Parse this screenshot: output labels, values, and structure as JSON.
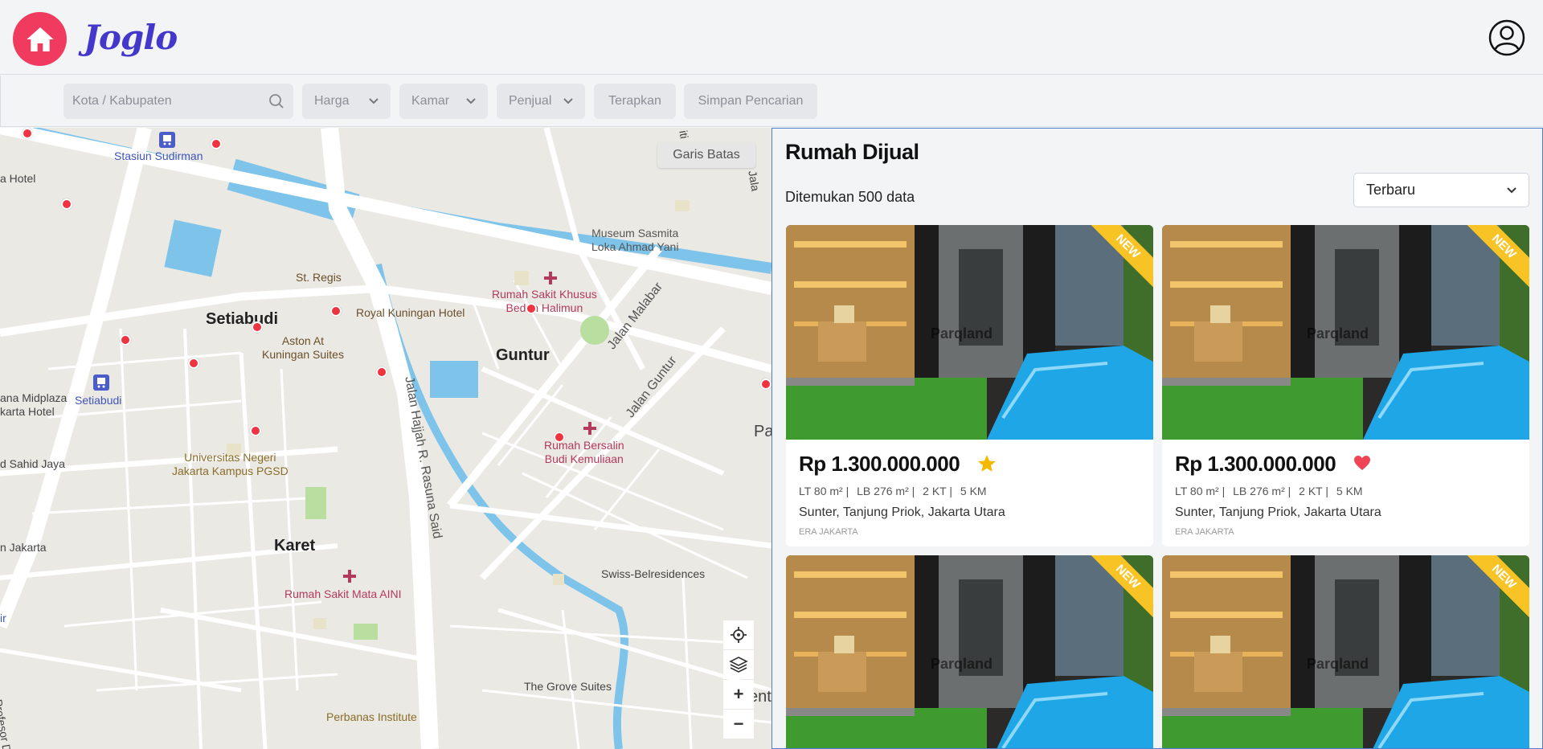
{
  "header": {
    "logo_text": "Joglo",
    "home_icon": "home-icon",
    "profile_icon": "user-circle-icon"
  },
  "filters": {
    "search_placeholder": "Kota / Kabupaten",
    "price_label": "Harga",
    "rooms_label": "Kamar",
    "seller_label": "Penjual",
    "apply_label": "Terapkan",
    "save_label": "Simpan Pencarian"
  },
  "map": {
    "boundary_button": "Garis Batas",
    "labels": {
      "stasiun_sudirman": "Stasiun Sudirman",
      "hotel_edge": "a Hotel",
      "st_regis": "St. Regis",
      "royal_kuningan": "Royal Kuningan Hotel",
      "setiabudi_district": "Setiabudi",
      "aston": "Aston At\nKuningan Suites",
      "midplaza": "ana Midplaza\nkarta Hotel",
      "setiabudi_station": "Setiabudi",
      "sahid": "d Sahid Jaya",
      "unj": "Universitas Negeri\nJakarta Kampus PGSD",
      "jakarta_edge": "n Jakarta",
      "karet": "Karet",
      "mata_aini": "Rumah Sakit Mata AINI",
      "guntur": "Guntur",
      "rs_khusus": "Rumah Sakit Khusus\nBedah Halimun",
      "museum": "Museum Sasmita\nLoka Ahmad Yani",
      "jalan_malabar": "Jalan Malabar",
      "jalan_guntur": "Jalan Guntur",
      "rasuna_said": "Jalan Hajjah R. Rasuna Said",
      "rs_bersalin": "Rumah Bersalin\nBudi Kemuliaan",
      "swiss": "Swiss-Belresidences",
      "grove": "The Grove Suites",
      "perbanas": "Perbanas Institute",
      "profesor": "alan Profesor Do",
      "pa_edge": "Pa",
      "ent_edge": "ent",
      "jala_edge": "Jala",
      "ir_edge": "ir",
      "iti_edge": "iti"
    },
    "controls": {
      "locate_icon": "crosshair-icon",
      "layers_icon": "layers-icon",
      "zoom_in": "+",
      "zoom_out": "−"
    }
  },
  "listing": {
    "title": "Rumah Dijual",
    "count_text": "Ditemukan 500 data",
    "sort_value": "Terbaru",
    "badge": "NEW",
    "cards": [
      {
        "price": "Rp 1.300.000.000",
        "lt": "LT 80 m² |",
        "lb": "LB 276 m² |",
        "kt": "2 KT |",
        "km": "5 KM",
        "location": "Sunter, Tanjung Priok, Jakarta Utara",
        "agent": "ERA JAKARTA",
        "icon": "star-icon",
        "icon_color": "#f5b800"
      },
      {
        "price": "Rp 1.300.000.000",
        "lt": "LT 80 m² |",
        "lb": "LB 276 m² |",
        "kt": "2 KT |",
        "km": "5 KM",
        "location": "Sunter, Tanjung Priok, Jakarta Utara",
        "agent": "ERA JAKARTA",
        "icon": "heart-icon",
        "icon_color": "#ef4455"
      }
    ],
    "watermark": "Parqland"
  },
  "colors": {
    "accent_pink": "#f03a5e",
    "logo_blue": "#4338ca",
    "panel_border": "#4f7fd1",
    "pin_red": "#ef3340",
    "badge_yellow": "#f7c325"
  }
}
